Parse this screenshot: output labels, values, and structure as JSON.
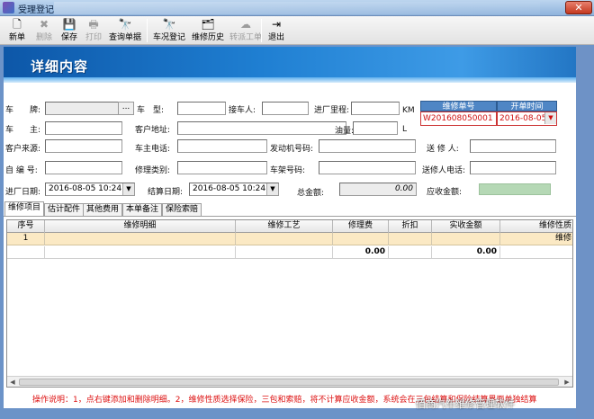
{
  "window": {
    "title": "受理登记",
    "close": "✕"
  },
  "toolbar": {
    "items": [
      {
        "label": "新单",
        "icon": "🗋"
      },
      {
        "label": "删除",
        "icon": "✖"
      },
      {
        "label": "保存",
        "icon": "💾"
      },
      {
        "label": "打印",
        "icon": "🖶"
      },
      {
        "label": "查询单据",
        "icon": "🔭"
      },
      {
        "label": "车况登记",
        "icon": "🔭"
      },
      {
        "label": "维修历史",
        "icon": "🗂"
      },
      {
        "label": "转派工单",
        "icon": "☁"
      },
      {
        "label": "退出",
        "icon": "⇥"
      }
    ]
  },
  "banner": {
    "title": "详细内容"
  },
  "form": {
    "plate_label": "车　　牌:",
    "plate_value": "",
    "plate_btn": "...",
    "model_label": "车　型:",
    "receiver_label": "接车人:",
    "mileage_label": "进厂里程:",
    "mileage_unit": "KM",
    "owner_label": "车　　主:",
    "address_label": "客户地址:",
    "fuel_label": "油量:",
    "fuel_unit": "L",
    "source_label": "客户来源:",
    "phone_label": "车主电话:",
    "engine_label": "发动机号码:",
    "sender_label": "送 修 人:",
    "selfno_label": "自 编 号:",
    "repair_type_label": "修理类别:",
    "frame_label": "车架号码:",
    "sender_phone_label": "送修人电话:",
    "in_date_label": "进厂日期:",
    "in_date_value": "2016-08-05 10:24",
    "settle_date_label": "结算日期:",
    "settle_date_value": "2016-08-05 10:24",
    "total_label": "总金额:",
    "total_value": "0.00",
    "receivable_label": "应收金额:",
    "order_no_header": "维修单号",
    "order_no_value": "W201608050001",
    "open_date_header": "开单时间",
    "open_date_value": "2016-08-05"
  },
  "tabs": [
    "维修项目",
    "估计配件",
    "其他费用",
    "本单备注",
    "保险索赔"
  ],
  "grid": {
    "headers": [
      "序号",
      "维修明细",
      "维修工艺",
      "修理费",
      "折扣",
      "实收金额",
      "维修性质"
    ],
    "row1": {
      "index": "1",
      "nature": "维修"
    },
    "row2": {
      "fee": "0.00",
      "actual": "0.00"
    }
  },
  "note": "操作说明：1，点右键添加和删除明细。2，维修性质选择保险，三包和索赔，将不计算应收金额，系统会在三包结算和保险结算界面单独结算",
  "watermark": "佰商汽车维修管理软件",
  "colors": {
    "banner": "#1f7fd2",
    "note": "#dd1111",
    "row_highlight": "#fbe9c4",
    "order_no": "#d01010"
  }
}
